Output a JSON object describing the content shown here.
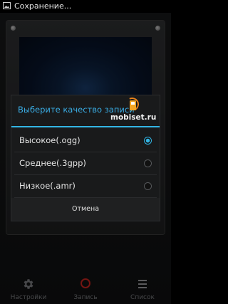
{
  "status_bar": {
    "title": "Сохранение..."
  },
  "dialog": {
    "title": "Выберите качество записи",
    "options": [
      {
        "label": "Высокое(.ogg)",
        "selected": true
      },
      {
        "label": "Среднее(.3gpp)",
        "selected": false
      },
      {
        "label": "Низкое(.amr)",
        "selected": false
      }
    ],
    "cancel_label": "Отмена"
  },
  "bottom_bar": {
    "settings_label": "Настройки",
    "record_label": "Запись",
    "list_label": "Список"
  },
  "watermark": {
    "text": "mobiset.ru"
  },
  "colors": {
    "accent": "#33b5e5",
    "record": "#b2211d",
    "watermark_orange": "#f5a623"
  },
  "icons": {
    "status": "image-icon",
    "settings": "gear-icon",
    "record": "record-icon",
    "list": "list-icon"
  }
}
